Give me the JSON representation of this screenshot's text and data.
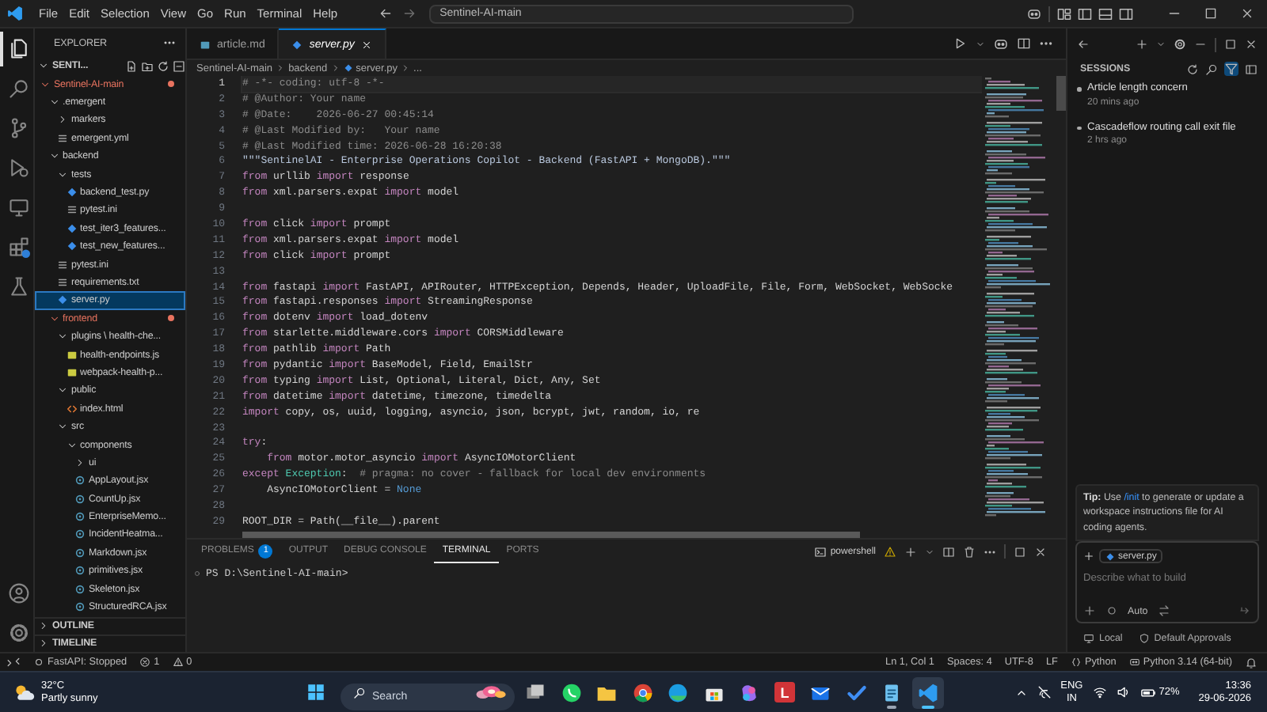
{
  "title_bar": {
    "menu": [
      "File",
      "Edit",
      "Selection",
      "View",
      "Go",
      "Run",
      "Terminal",
      "Help"
    ],
    "command_center": "Sentinel-AI-main"
  },
  "activity_bar": {
    "items": [
      {
        "kind": "explorer",
        "selected": true
      },
      {
        "kind": "search",
        "selected": false
      },
      {
        "kind": "source-control",
        "selected": false
      },
      {
        "kind": "run-debug",
        "selected": false
      },
      {
        "kind": "remote",
        "selected": false
      },
      {
        "kind": "extensions",
        "selected": false
      },
      {
        "kind": "testing",
        "selected": false
      }
    ]
  },
  "explorer": {
    "title": "EXPLORER",
    "workspace": "SENTI...",
    "tree": [
      {
        "label": "Sentinel-AI-main",
        "kind": "folder",
        "expanded": true,
        "modified": true,
        "selected": false,
        "children": [
          {
            "label": ".emergent",
            "kind": "folder",
            "expanded": true,
            "modified": false,
            "selected": false,
            "children": [
              {
                "label": "markers",
                "kind": "folder",
                "expanded": false,
                "modified": false,
                "selected": false
              },
              {
                "label": "emergent.yml",
                "kind": "config",
                "modified": false,
                "selected": false
              }
            ]
          },
          {
            "label": "backend",
            "kind": "folder",
            "expanded": true,
            "modified": false,
            "selected": false,
            "children": [
              {
                "label": "tests",
                "kind": "folder",
                "expanded": true,
                "modified": false,
                "selected": false,
                "children": [
                  {
                    "label": "backend_test.py",
                    "kind": "python",
                    "modified": false,
                    "selected": false
                  },
                  {
                    "label": "pytest.ini",
                    "kind": "config",
                    "modified": false,
                    "selected": false
                  },
                  {
                    "label": "test_iter3_features...",
                    "kind": "python",
                    "modified": false,
                    "selected": false
                  },
                  {
                    "label": "test_new_features...",
                    "kind": "python",
                    "modified": false,
                    "selected": false
                  }
                ]
              },
              {
                "label": "pytest.ini",
                "kind": "config",
                "modified": false,
                "selected": false
              },
              {
                "label": "requirements.txt",
                "kind": "config",
                "modified": false,
                "selected": false
              },
              {
                "label": "server.py",
                "kind": "python",
                "modified": false,
                "selected": true
              }
            ]
          },
          {
            "label": "frontend",
            "kind": "folder",
            "expanded": true,
            "modified": true,
            "selected": false,
            "children": [
              {
                "label": "plugins \\ health-che...",
                "kind": "folder",
                "expanded": true,
                "modified": false,
                "selected": false,
                "children": [
                  {
                    "label": "health-endpoints.js",
                    "kind": "js",
                    "modified": false,
                    "selected": false
                  },
                  {
                    "label": "webpack-health-p...",
                    "kind": "js",
                    "modified": false,
                    "selected": false
                  }
                ]
              },
              {
                "label": "public",
                "kind": "folder",
                "expanded": true,
                "modified": false,
                "selected": false,
                "children": [
                  {
                    "label": "index.html",
                    "kind": "html",
                    "modified": false,
                    "selected": false
                  }
                ]
              },
              {
                "label": "src",
                "kind": "folder",
                "expanded": true,
                "modified": false,
                "selected": false,
                "children": [
                  {
                    "label": "components",
                    "kind": "folder",
                    "expanded": true,
                    "modified": false,
                    "selected": false,
                    "children": [
                      {
                        "label": "ui",
                        "kind": "folder",
                        "expanded": false,
                        "modified": false,
                        "selected": false
                      },
                      {
                        "label": "AppLayout.jsx",
                        "kind": "react",
                        "modified": false,
                        "selected": false
                      },
                      {
                        "label": "CountUp.jsx",
                        "kind": "react",
                        "modified": false,
                        "selected": false
                      },
                      {
                        "label": "EnterpriseMemo...",
                        "kind": "react",
                        "modified": false,
                        "selected": false
                      },
                      {
                        "label": "IncidentHeatma...",
                        "kind": "react",
                        "modified": false,
                        "selected": false
                      },
                      {
                        "label": "Markdown.jsx",
                        "kind": "react",
                        "modified": false,
                        "selected": false
                      },
                      {
                        "label": "primitives.jsx",
                        "kind": "react",
                        "modified": false,
                        "selected": false
                      },
                      {
                        "label": "Skeleton.jsx",
                        "kind": "react",
                        "modified": false,
                        "selected": false
                      },
                      {
                        "label": "StructuredRCA.jsx",
                        "kind": "react",
                        "modified": false,
                        "selected": false
                      }
                    ]
                  }
                ]
              }
            ]
          }
        ]
      }
    ],
    "sections": [
      {
        "label": "OUTLINE",
        "expanded": false
      },
      {
        "label": "TIMELINE",
        "expanded": false
      }
    ]
  },
  "editor": {
    "tabs": [
      {
        "label": "article.md",
        "kind": "markdown",
        "selected": false
      },
      {
        "label": "server.py",
        "kind": "python",
        "selected": true
      }
    ],
    "breadcrumb": [
      "Sentinel-AI-main",
      "backend",
      "server.py",
      "..."
    ],
    "lines": [
      {
        "number": "1",
        "current": true,
        "tokens": [
          {
            "kind": "comment",
            "text": "# -*- coding: utf-8 -*-"
          }
        ]
      },
      {
        "number": "2",
        "current": false,
        "tokens": [
          {
            "kind": "comment",
            "text": "# @Author: Your name"
          }
        ]
      },
      {
        "number": "3",
        "current": false,
        "tokens": [
          {
            "kind": "comment",
            "text": "# @Date:    2026-06-27 00:45:14"
          }
        ]
      },
      {
        "number": "4",
        "current": false,
        "tokens": [
          {
            "kind": "comment",
            "text": "# @Last Modified by:   Your name"
          }
        ]
      },
      {
        "number": "5",
        "current": false,
        "tokens": [
          {
            "kind": "comment",
            "text": "# @Last Modified time: 2026-06-28 16:20:38"
          }
        ]
      },
      {
        "number": "6",
        "current": false,
        "tokens": [
          {
            "kind": "string",
            "text": "\"\"\"SentinelAI - Enterprise Operations Copilot - Backend (FastAPI + MongoDB).\"\"\""
          }
        ]
      },
      {
        "number": "7",
        "current": false,
        "tokens": [
          {
            "kind": "keyword",
            "text": "from"
          },
          {
            "kind": "plain",
            "text": " urllib "
          },
          {
            "kind": "keyword",
            "text": "import"
          },
          {
            "kind": "plain",
            "text": " response"
          }
        ]
      },
      {
        "number": "8",
        "current": false,
        "tokens": [
          {
            "kind": "keyword",
            "text": "from"
          },
          {
            "kind": "plain",
            "text": " xml.parsers.expat "
          },
          {
            "kind": "keyword",
            "text": "import"
          },
          {
            "kind": "plain",
            "text": " model"
          }
        ]
      },
      {
        "number": "9",
        "current": false
      },
      {
        "number": "10",
        "current": false,
        "tokens": [
          {
            "kind": "keyword",
            "text": "from"
          },
          {
            "kind": "plain",
            "text": " click "
          },
          {
            "kind": "keyword",
            "text": "import"
          },
          {
            "kind": "plain",
            "text": " prompt"
          }
        ]
      },
      {
        "number": "11",
        "current": false,
        "tokens": [
          {
            "kind": "keyword",
            "text": "from"
          },
          {
            "kind": "plain",
            "text": " xml.parsers.expat "
          },
          {
            "kind": "keyword",
            "text": "import"
          },
          {
            "kind": "plain",
            "text": " model"
          }
        ]
      },
      {
        "number": "12",
        "current": false,
        "tokens": [
          {
            "kind": "keyword",
            "text": "from"
          },
          {
            "kind": "plain",
            "text": " click "
          },
          {
            "kind": "keyword",
            "text": "import"
          },
          {
            "kind": "plain",
            "text": " prompt"
          }
        ]
      },
      {
        "number": "13",
        "current": false
      },
      {
        "number": "14",
        "current": false,
        "tokens": [
          {
            "kind": "keyword",
            "text": "from"
          },
          {
            "kind": "plain",
            "text": " fastapi "
          },
          {
            "kind": "keyword",
            "text": "import"
          },
          {
            "kind": "plain",
            "text": " FastAPI, APIRouter, HTTPException, Depends, Header, UploadFile, File, Form, WebSocket, WebSocke"
          }
        ]
      },
      {
        "number": "15",
        "current": false,
        "tokens": [
          {
            "kind": "keyword",
            "text": "from"
          },
          {
            "kind": "plain",
            "text": " fastapi.responses "
          },
          {
            "kind": "keyword",
            "text": "import"
          },
          {
            "kind": "plain",
            "text": " StreamingResponse"
          }
        ]
      },
      {
        "number": "16",
        "current": false,
        "tokens": [
          {
            "kind": "keyword",
            "text": "from"
          },
          {
            "kind": "plain",
            "text": " dotenv "
          },
          {
            "kind": "keyword",
            "text": "import"
          },
          {
            "kind": "plain",
            "text": " load_dotenv"
          }
        ]
      },
      {
        "number": "17",
        "current": false,
        "tokens": [
          {
            "kind": "keyword",
            "text": "from"
          },
          {
            "kind": "plain",
            "text": " starlette.middleware.cors "
          },
          {
            "kind": "keyword",
            "text": "import"
          },
          {
            "kind": "plain",
            "text": " CORSMiddleware"
          }
        ]
      },
      {
        "number": "18",
        "current": false,
        "tokens": [
          {
            "kind": "keyword",
            "text": "from"
          },
          {
            "kind": "plain",
            "text": " pathlib "
          },
          {
            "kind": "keyword",
            "text": "import"
          },
          {
            "kind": "plain",
            "text": " Path"
          }
        ]
      },
      {
        "number": "19",
        "current": false,
        "tokens": [
          {
            "kind": "keyword",
            "text": "from"
          },
          {
            "kind": "plain",
            "text": " pydantic "
          },
          {
            "kind": "keyword",
            "text": "import"
          },
          {
            "kind": "plain",
            "text": " BaseModel, Field, EmailStr"
          }
        ]
      },
      {
        "number": "20",
        "current": false,
        "tokens": [
          {
            "kind": "keyword",
            "text": "from"
          },
          {
            "kind": "plain",
            "text": " typing "
          },
          {
            "kind": "keyword",
            "text": "import"
          },
          {
            "kind": "plain",
            "text": " List, Optional, Literal, Dict, Any, Set"
          }
        ]
      },
      {
        "number": "21",
        "current": false,
        "tokens": [
          {
            "kind": "keyword",
            "text": "from"
          },
          {
            "kind": "plain",
            "text": " datetime "
          },
          {
            "kind": "keyword",
            "text": "import"
          },
          {
            "kind": "plain",
            "text": " datetime, timezone, timedelta"
          }
        ]
      },
      {
        "number": "22",
        "current": false,
        "tokens": [
          {
            "kind": "keyword",
            "text": "import"
          },
          {
            "kind": "plain",
            "text": " copy, os, uuid, logging, asyncio, json, bcrypt, jwt, random, io, re"
          }
        ]
      },
      {
        "number": "23",
        "current": false
      },
      {
        "number": "24",
        "current": false,
        "tokens": [
          {
            "kind": "keyword",
            "text": "try"
          },
          {
            "kind": "plain",
            "text": ":"
          }
        ]
      },
      {
        "number": "25",
        "current": false,
        "tokens": [
          {
            "kind": "keyword",
            "text": "    from"
          },
          {
            "kind": "plain",
            "text": " motor.motor_asyncio "
          },
          {
            "kind": "keyword",
            "text": "import"
          },
          {
            "kind": "plain",
            "text": " AsyncIOMotorClient"
          }
        ]
      },
      {
        "number": "26",
        "current": false,
        "tokens": [
          {
            "kind": "keyword",
            "text": "except"
          },
          {
            "kind": "class",
            "text": " Exception"
          },
          {
            "kind": "plain",
            "text": ":  "
          },
          {
            "kind": "comment",
            "text": "# pragma: no cover - fallback for local dev environments"
          }
        ]
      },
      {
        "number": "27",
        "current": false,
        "tokens": [
          {
            "kind": "plain",
            "text": "    AsyncIOMotorClient = "
          },
          {
            "kind": "constant",
            "text": "None"
          }
        ]
      },
      {
        "number": "28",
        "current": false
      },
      {
        "number": "29",
        "current": false,
        "tokens": [
          {
            "kind": "plain",
            "text": "ROOT_DIR = Path(__file__).parent"
          }
        ]
      }
    ]
  },
  "panel": {
    "tabs": [
      {
        "label": "PROBLEMS",
        "badge": "1",
        "selected": false
      },
      {
        "label": "OUTPUT",
        "selected": false
      },
      {
        "label": "DEBUG CONSOLE",
        "selected": false
      },
      {
        "label": "TERMINAL",
        "selected": true
      },
      {
        "label": "PORTS",
        "selected": false
      }
    ],
    "terminal_profile": "powershell",
    "terminal_lines": [
      "PS D:\\Sentinel-AI-main>"
    ]
  },
  "chat": {
    "title": "SESSIONS",
    "sessions": [
      {
        "title": "Article length concern",
        "time": "20 mins ago"
      },
      {
        "title": "Cascadeflow routing call exit file",
        "time": "2 hrs ago"
      }
    ],
    "tip": {
      "before": "**Tip:** Use ",
      "link": "/init",
      "after": " to generate or update a workspace instructions file for AI coding agents."
    },
    "input": {
      "attachment": "server.py",
      "placeholder": "Describe what to build",
      "mode": "Auto"
    },
    "footer": [
      {
        "kind": "local",
        "text": "Local"
      },
      {
        "kind": "approvals",
        "text": "Default Approvals"
      }
    ]
  },
  "status_bar": {
    "left": [
      {
        "kind": "app-status",
        "text": "FastAPI: Stopped"
      },
      {
        "kind": "errors",
        "text": "1"
      },
      {
        "kind": "warnings",
        "text": "0"
      }
    ],
    "right": [
      {
        "kind": "text",
        "text": "Ln 1, Col 1"
      },
      {
        "kind": "text",
        "text": "Spaces: 4"
      },
      {
        "kind": "text",
        "text": "UTF-8"
      },
      {
        "kind": "text",
        "text": "LF"
      },
      {
        "kind": "language",
        "text": "Python"
      },
      {
        "kind": "interpreter",
        "text": "Python 3.14 (64-bit)"
      }
    ]
  },
  "taskbar": {
    "weather": {
      "temp": "32°C",
      "condition": "Partly sunny"
    },
    "search": {
      "placeholder": "Search"
    },
    "apps": [
      {
        "kind": "photos",
        "open": false,
        "selected": false
      },
      {
        "kind": "messaging",
        "open": false,
        "selected": false
      },
      {
        "kind": "files",
        "open": false,
        "selected": false
      },
      {
        "kind": "browser",
        "open": false,
        "selected": false
      },
      {
        "kind": "web-browser",
        "open": false,
        "selected": false
      },
      {
        "kind": "store",
        "open": false,
        "selected": false
      },
      {
        "kind": "assistant",
        "open": false,
        "selected": false
      },
      {
        "kind": "letter",
        "text": "L",
        "open": false,
        "selected": false
      },
      {
        "kind": "mail",
        "open": false,
        "selected": false
      },
      {
        "kind": "todo",
        "open": false,
        "selected": false
      },
      {
        "kind": "notepad",
        "open": true,
        "selected": false
      },
      {
        "kind": "code-editor",
        "open": true,
        "selected": true
      }
    ],
    "tray": {
      "language": [
        "ENG",
        "IN"
      ],
      "battery": "72%",
      "time": "13:36",
      "date": "29-06-2026"
    }
  }
}
